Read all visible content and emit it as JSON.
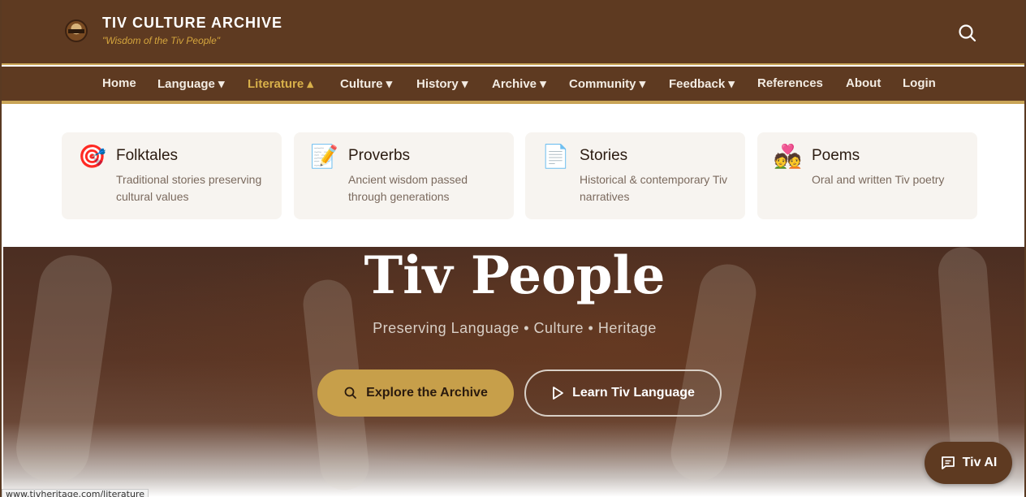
{
  "header": {
    "brand_title": "TIV CULTURE ARCHIVE",
    "brand_tagline": "\"Wisdom of the Tiv People\"",
    "logo_icon": "tiv-heritage-logo",
    "search_icon": "search-icon"
  },
  "nav": {
    "items": [
      {
        "label": "Home"
      },
      {
        "label": "Language ▾"
      },
      {
        "label": "Literature ▴",
        "active": true
      },
      {
        "label": "Culture ▾"
      },
      {
        "label": "History ▾"
      },
      {
        "label": "Archive ▾"
      },
      {
        "label": "Community ▾"
      },
      {
        "label": "Feedback ▾"
      },
      {
        "label": "References"
      },
      {
        "label": "About"
      },
      {
        "label": "Login"
      }
    ]
  },
  "literature_menu": {
    "cards": [
      {
        "icon": "🎯",
        "icon_name": "target-icon",
        "title": "Folktales",
        "desc": "Traditional stories preserving cultural values"
      },
      {
        "icon": "📝",
        "icon_name": "memo-icon",
        "title": "Proverbs",
        "desc": "Ancient wisdom passed through generations"
      },
      {
        "icon": "📄",
        "icon_name": "document-icon",
        "title": "Stories",
        "desc": "Historical & contemporary Tiv narratives"
      },
      {
        "icon": "💑",
        "icon_name": "couple-icon",
        "title": "Poems",
        "desc": "Oral and written Tiv poetry"
      }
    ]
  },
  "hero": {
    "title": "Tiv People",
    "subtitle": "Preserving Language • Culture • Heritage",
    "primary_button": "Explore the Archive",
    "secondary_button": "Learn Tiv Language"
  },
  "ai_button": {
    "label": "Tiv AI",
    "icon": "chat-icon"
  },
  "status_bar": {
    "url": "www.tivheritage.com/literature"
  },
  "colors": {
    "brand_brown": "#5e3a21",
    "accent_gold": "#c9a557",
    "active_nav": "#d8b04a"
  }
}
